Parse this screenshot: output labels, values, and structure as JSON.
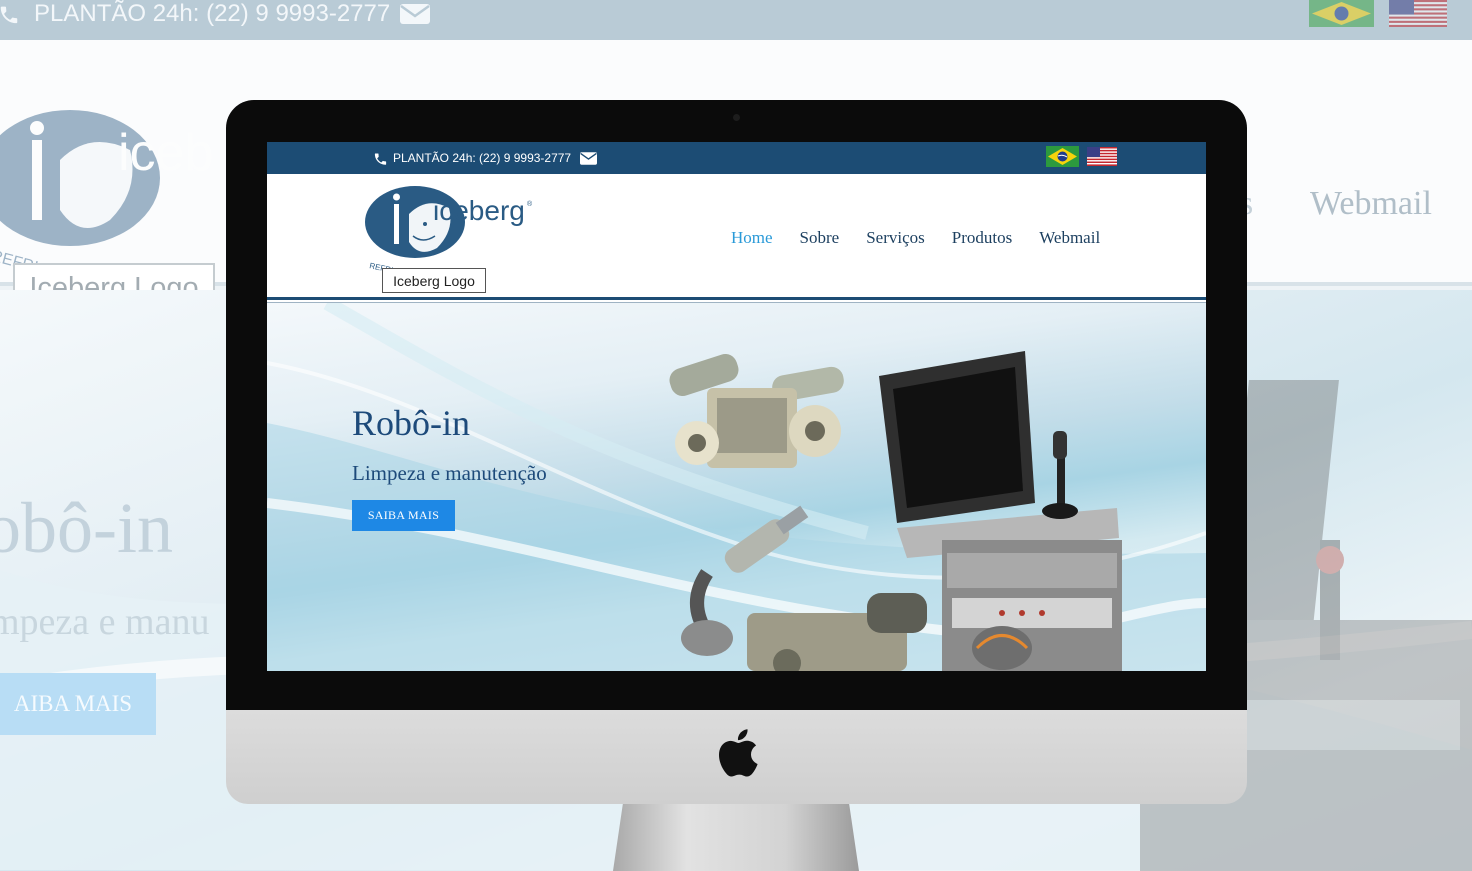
{
  "topbar": {
    "phone_text": "PLANTÃO 24h: (22) 9 9993-2777",
    "phone_icon": "phone-icon",
    "mail_icon": "envelope-icon",
    "flags": [
      "brazil-flag-icon",
      "usa-flag-icon"
    ]
  },
  "header": {
    "logo_text": "iceberg",
    "logo_tagline": "REFRIGERAÇÃO NAVAL",
    "logo_tooltip": "Iceberg Logo",
    "nav": [
      "Home",
      "Sobre",
      "Serviços",
      "Produtos",
      "Webmail"
    ],
    "active_nav": "Home"
  },
  "hero": {
    "title": "Robô-in",
    "subtitle": "Limpeza e manutenção",
    "button": "SAIBA MAIS"
  },
  "background": {
    "phone_text": "PLANTÃO 24h: (22) 9 9993-2777",
    "logo_tooltip": "Iceberg Logo",
    "nav_partial": "s",
    "nav_webmail": "Webmail",
    "hero_title": "obô-in",
    "hero_subtitle": "mpeza e manu",
    "hero_button": "AIBA MAIS"
  },
  "colors": {
    "topbar": "#1c4c74",
    "nav_active": "#2a9ad8",
    "nav_text": "#1c3f5f",
    "hero_text": "#1d4a7a",
    "button": "#1e88e5",
    "bezel": "#0b0b0b"
  },
  "device": {
    "apple_icon": "apple-logo-icon"
  }
}
